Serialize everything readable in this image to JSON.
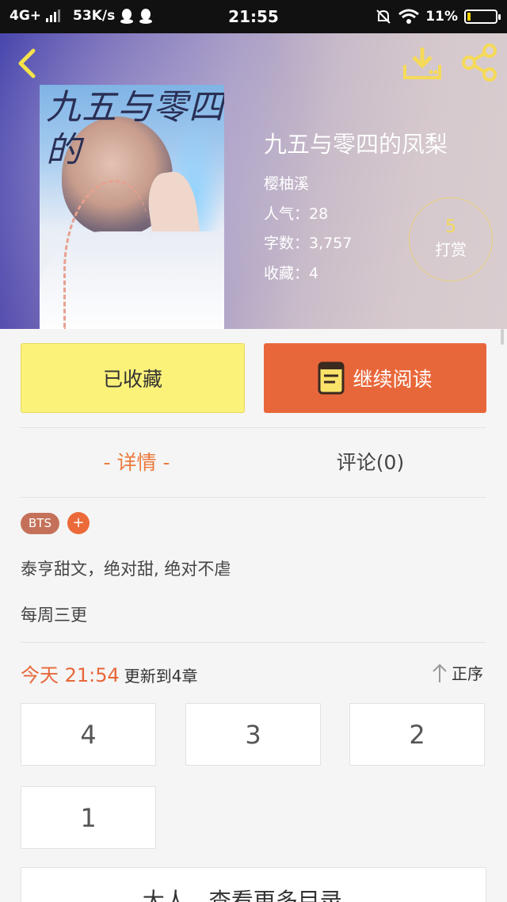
{
  "status_bar": {
    "network": "4G+",
    "speed": "53K/s",
    "time": "21:55",
    "battery": "11%",
    "icons": [
      "signal-icon",
      "qq-icon",
      "qq-icon",
      "mute-bell-icon",
      "wifi-icon",
      "battery-icon"
    ]
  },
  "header": {
    "back_icon": "back-chevron-icon",
    "download_icon": "download-icon",
    "share_icon": "share-icon",
    "accent_color": "#f5da58"
  },
  "book": {
    "cover_title": "九五与零四的",
    "title": "九五与零四的凤梨",
    "author": "樱柚溪",
    "popularity": "人气：28",
    "word_count": "字数：3,757",
    "favorites": "收藏：4",
    "reward_count": "5",
    "reward_label": "打赏"
  },
  "actions": {
    "favorited_label": "已收藏",
    "continue_label": "继续阅读",
    "favorited_color": "#fbf27a",
    "continue_color": "#e8673a"
  },
  "tabs": {
    "detail": "- 详情 -",
    "comments": "评论(0)"
  },
  "tags": {
    "items": [
      "BTS"
    ],
    "add": "+"
  },
  "description": {
    "line1": "泰亨甜文，绝对甜, 绝对不虐",
    "line2": "每周三更"
  },
  "updates": {
    "time": "今天 21:54",
    "text": "更新到4章",
    "order": "正序"
  },
  "chapters": [
    "4",
    "3",
    "2",
    "1"
  ],
  "more": {
    "label": "大人，查看更多目录",
    "chevron": "⌄"
  }
}
